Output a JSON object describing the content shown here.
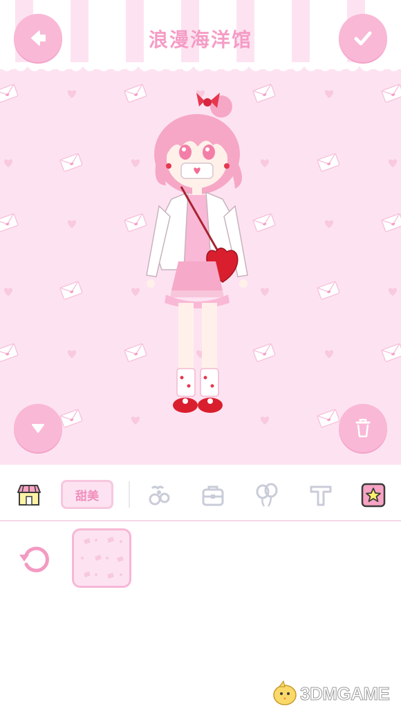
{
  "header": {
    "title": "浪漫海洋馆",
    "back_icon": "arrow-left-icon",
    "confirm_icon": "checkmark-icon"
  },
  "stage": {
    "background_color": "#fde3f1",
    "pattern_icons": [
      "envelope-icon",
      "heart-icon"
    ],
    "collapse_icon": "triangle-down-icon",
    "delete_icon": "trash-icon"
  },
  "tabs": {
    "shop_icon": "shop-icon",
    "active_label": "甜美",
    "items": [
      "accessory-icon",
      "bag-icon",
      "balloon-icon",
      "text-icon"
    ],
    "favorite_icon": "star-icon"
  },
  "panel": {
    "reset_icon": "refresh-icon",
    "selected_background": "envelope-pattern"
  },
  "watermark": {
    "text": "3DMGAME"
  },
  "colors": {
    "accent_pink": "#f9b8d6",
    "title_pink": "#f59cc5",
    "panel_bg": "#ffffff"
  }
}
